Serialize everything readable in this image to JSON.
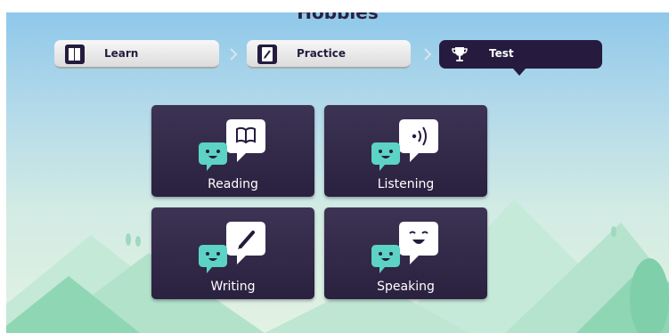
{
  "header": {
    "title": "Hobbies"
  },
  "stepper": {
    "steps": [
      {
        "label": "Learn",
        "icon": "book-icon",
        "active": false
      },
      {
        "label": "Practice",
        "icon": "pencil-note-icon",
        "active": false
      },
      {
        "label": "Test",
        "icon": "trophy-icon",
        "active": true
      }
    ]
  },
  "skills": [
    {
      "label": "Reading",
      "icon": "book-icon"
    },
    {
      "label": "Listening",
      "icon": "sound-waves-icon"
    },
    {
      "label": "Writing",
      "icon": "pencil-icon"
    },
    {
      "label": "Speaking",
      "icon": "smile-face-icon"
    }
  ],
  "colors": {
    "navy": "#261b3e",
    "tile": "#2f2645",
    "teal_bubble": "#5cd3c4",
    "sky_top": "#8fc8ea",
    "mountain": "#a7dfc8"
  }
}
